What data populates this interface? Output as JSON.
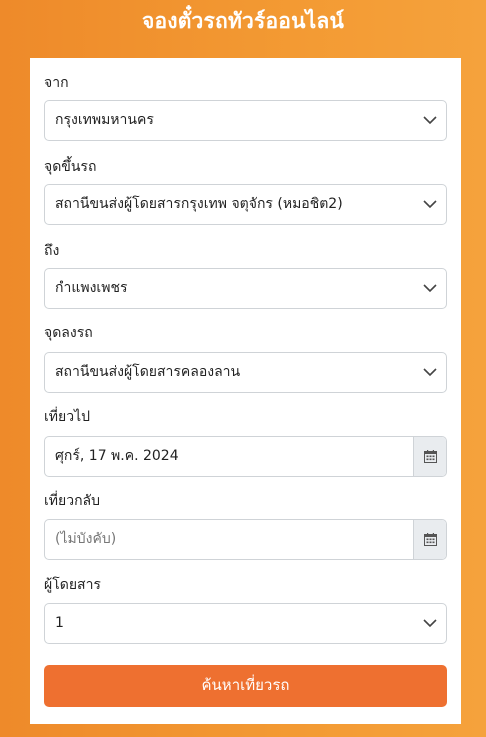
{
  "header": {
    "title": "จองตั๋วรถทัวร์ออนไลน์"
  },
  "form": {
    "from": {
      "label": "จาก",
      "value": "กรุงเทพมหานคร"
    },
    "boarding": {
      "label": "จุดขึ้นรถ",
      "value": "สถานีขนส่งผู้โดยสารกรุงเทพ จตุจักร (หมอชิต2)"
    },
    "to": {
      "label": "ถึง",
      "value": "กำแพงเพชร"
    },
    "dropoff": {
      "label": "จุดลงรถ",
      "value": "สถานีขนส่งผู้โดยสารคลองลาน"
    },
    "depart": {
      "label": "เที่ยวไป",
      "value": "ศุกร์, 17 พ.ค. 2024"
    },
    "return": {
      "label": "เที่ยวกลับ",
      "placeholder": "(ไม่บังคับ)"
    },
    "passengers": {
      "label": "ผู้โดยสาร",
      "value": "1"
    },
    "submit_label": "ค้นหาเที่ยวรถ"
  },
  "colors": {
    "background": "#f0922e",
    "button": "#ee7030",
    "card": "#ffffff"
  },
  "icons": {
    "select": "chevron-down-icon",
    "date": "calendar-icon"
  }
}
